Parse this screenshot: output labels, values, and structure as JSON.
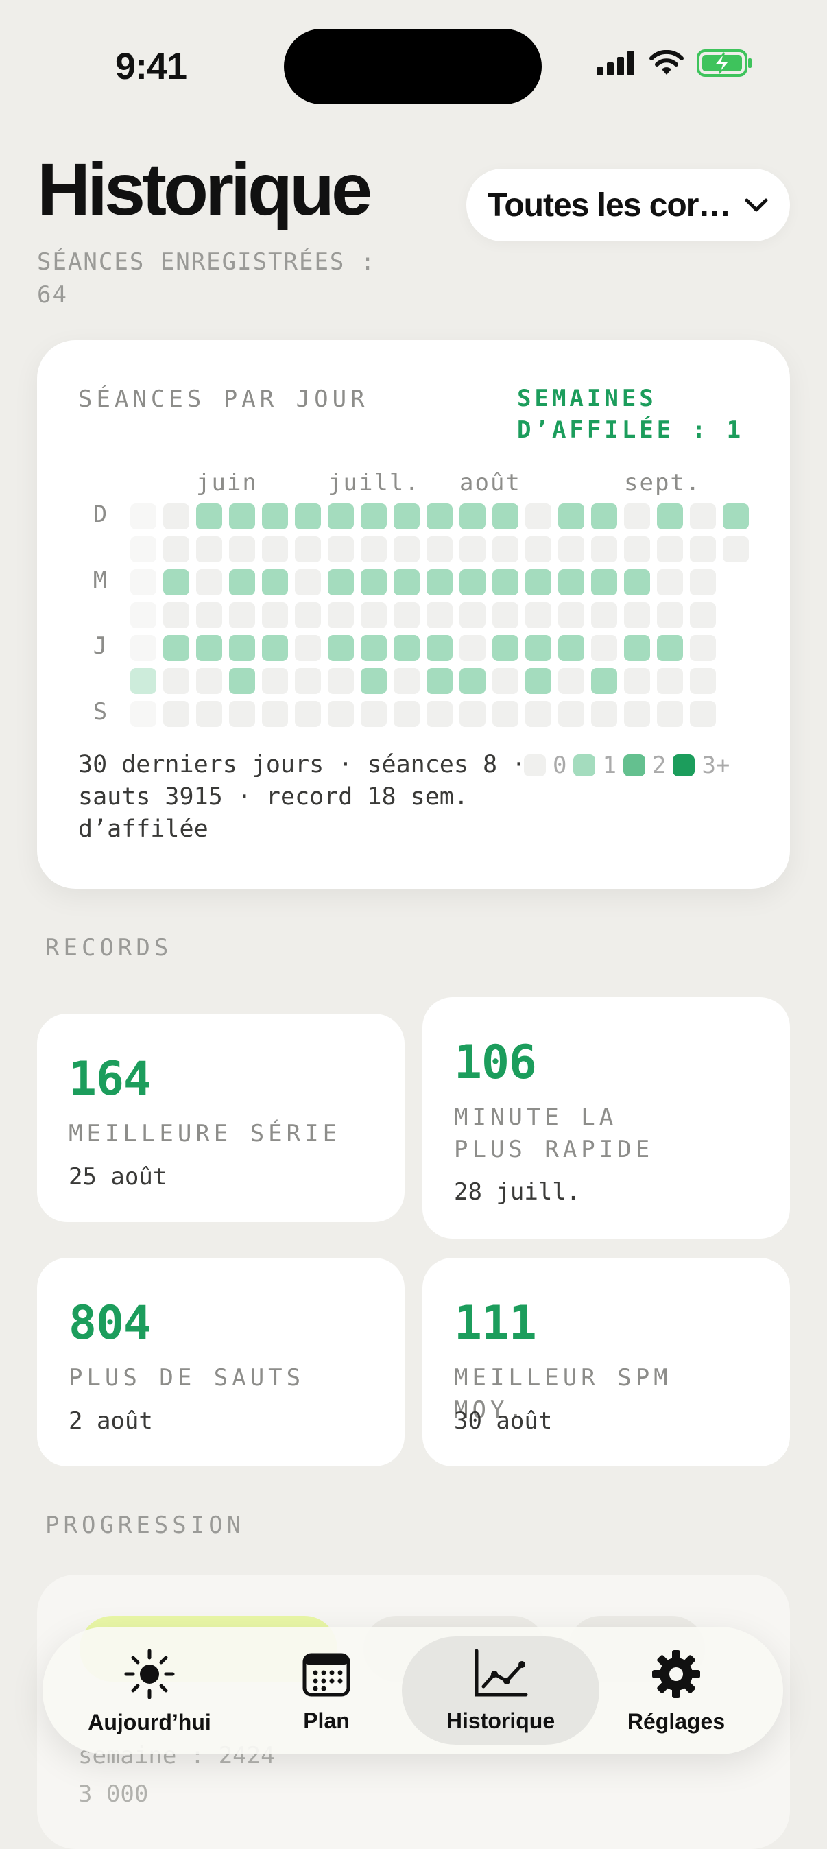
{
  "status": {
    "time": "9:41"
  },
  "header": {
    "title": "Historique",
    "subtitle": "SÉANCES ENREGISTRÉES : 64",
    "filter_label": "Toutes les cor…"
  },
  "heatmap": {
    "title": "SÉANCES PAR JOUR",
    "streak": "SEMAINES D’AFFILÉE : 1",
    "months": [
      "juin",
      "juill.",
      "août",
      "sept."
    ],
    "day_labels": [
      "D",
      "M",
      "J",
      "S"
    ],
    "grid_levels": [
      [
        0,
        0,
        1,
        1,
        1,
        1,
        1,
        1,
        1,
        1,
        1,
        1,
        0,
        1,
        1,
        0,
        1,
        0,
        1
      ],
      [
        0,
        0,
        0,
        0,
        0,
        0,
        0,
        0,
        0,
        0,
        0,
        0,
        0,
        0,
        0,
        0,
        0,
        0,
        0
      ],
      [
        0,
        1,
        0,
        1,
        1,
        0,
        1,
        1,
        1,
        1,
        1,
        1,
        1,
        1,
        1,
        1,
        0,
        0
      ],
      [
        0,
        0,
        0,
        0,
        0,
        0,
        0,
        0,
        0,
        0,
        0,
        0,
        0,
        0,
        0,
        0,
        0,
        0
      ],
      [
        0,
        1,
        1,
        1,
        1,
        0,
        1,
        1,
        1,
        1,
        0,
        1,
        1,
        1,
        0,
        1,
        1,
        0
      ],
      [
        1,
        0,
        0,
        1,
        0,
        0,
        0,
        1,
        0,
        1,
        1,
        0,
        1,
        0,
        1,
        0,
        0,
        0
      ],
      [
        0,
        0,
        0,
        0,
        0,
        0,
        0,
        0,
        0,
        0,
        0,
        0,
        0,
        0,
        0,
        0,
        0,
        0
      ]
    ],
    "footer": "30 derniers jours · séances 8 · sauts 3915 · record 18 sem. d’affilée",
    "legend": [
      "0",
      "1",
      "2",
      "3+"
    ],
    "colors": {
      "level0": "#f0f0ee",
      "level1": "#a4dcbe",
      "level2": "#64c08f",
      "level3": "#1c9d5c"
    }
  },
  "records": {
    "label": "RECORDS",
    "items": [
      {
        "value": "164",
        "label": "MEILLEURE SÉRIE",
        "date": "25 août"
      },
      {
        "value": "106",
        "label": "MINUTE LA PLUS RAPIDE",
        "date": "28 juill."
      },
      {
        "value": "804",
        "label": "PLUS DE SAUTS",
        "date": "2 août"
      },
      {
        "value": "111",
        "label": "MEILLEUR SPM MOY.",
        "date": "30 août"
      }
    ]
  },
  "progression": {
    "label": "PROGRESSION",
    "partial_text_1": "semaine : 2424",
    "partial_text_2": "3 000"
  },
  "tabs": [
    {
      "label": "Aujourd’hui",
      "icon": "sun-icon"
    },
    {
      "label": "Plan",
      "icon": "calendar-icon"
    },
    {
      "label": "Historique",
      "icon": "chart-line-icon",
      "active": true
    },
    {
      "label": "Réglages",
      "icon": "gear-icon"
    }
  ],
  "accent_color": "#1c9d5c"
}
